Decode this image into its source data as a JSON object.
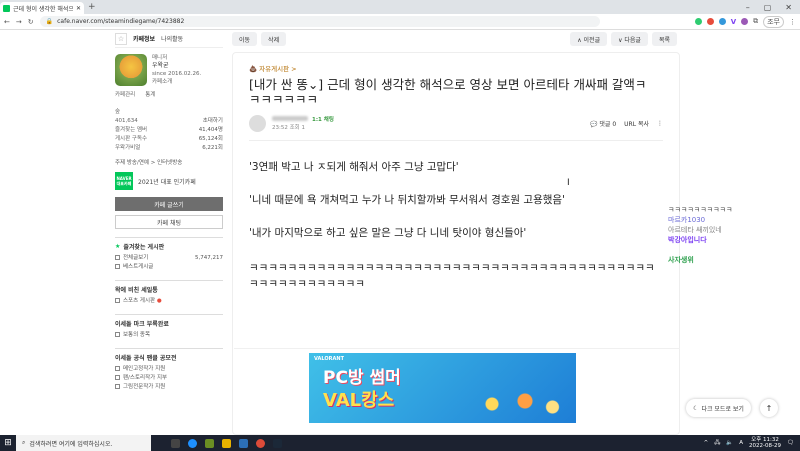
{
  "browser": {
    "tab_title": "근데 형이 생각한 해석으로 영상 보면...",
    "new_tab_symbol": "+",
    "window_controls": [
      "–",
      "▢",
      "✕"
    ],
    "url": "cafe.naver.com/steamindiegame/7423882",
    "profile_btn": "조무",
    "ext_letter": "V"
  },
  "sidebar": {
    "tabs": [
      "카페정보",
      "나의활동"
    ],
    "cafe": {
      "role": "매니저",
      "name": "우왁굳",
      "since": "since 2016.02.26.",
      "sub": "카페소개"
    },
    "admin": [
      "카페관리",
      "통계"
    ],
    "level_label": "숲",
    "members": {
      "count": "401,634",
      "label": "초대하기"
    },
    "stats": [
      {
        "label": "즐겨찾는 멤버",
        "value": "41,404명"
      },
      {
        "label": "게시판 구독수",
        "value": "65,124회"
      },
      {
        "label": "우왁가비얼",
        "value": "6,221회"
      }
    ],
    "theme_line": "주제 방송/연예 > 인터넷방송",
    "naver_badge": "NAVER 대표카페",
    "naver_text": "2021년 대표 인기카페",
    "write_btn": "카페 글쓰기",
    "chat_btn": "카페 채팅",
    "fav_section": "즐겨찾는 게시판",
    "fav_items": [
      {
        "label": "전체글보기",
        "value": "5,747,217"
      },
      {
        "label": "베스트게시글",
        "value": ""
      }
    ],
    "section2": "왁에 비친 세일통",
    "section2_items": [
      "스포츠 게시판"
    ],
    "section3": "이세돌 마크 부록완료",
    "section3_items": [
      "보통의 종목"
    ],
    "section4": "이세돌 공식 팬클 공모전",
    "section4_items": [
      "메인고정작가 지원",
      "팬/스토리작가 지부",
      "그림전문작가 지원"
    ]
  },
  "toolbar": {
    "move": "이동",
    "delete": "삭제",
    "prev": "∧ 이전글",
    "next": "∨ 다음글",
    "list": "목록"
  },
  "post": {
    "board": "자유게시판 >",
    "title": "[내가 싼 똥⌄] 근데 형이 생각한 해석으로 영상 보면 아르테타 개싸패 갈액ㅋㅋㅋㅋㅋㅋㅋ",
    "author_level": "1:1 채팅",
    "date": "23:52  조회 1",
    "comments": "댓글 0",
    "url_copy": "URL 복사",
    "paragraphs": [
      "'3연패 박고 나 ㅈ되게 해줘서 아주 그냥 고맙다'",
      "'니네 때문에 욕 개쳐먹고 누가 나 뒤치할까봐 무서워서 경호원 고용했음'",
      "'내가 마지막으로 하고 싶은 말은 그냥 다 니네 탓이야 형신들아'"
    ],
    "laughs": "ㅋㅋㅋㅋㅋㅋㅋㅋㅋㅋㅋㅋㅋㅋㅋㅋㅋㅋㅋㅋㅋㅋㅋㅋㅋㅋㅋㅋㅋㅋㅋㅋㅋㅋㅋㅋㅋㅋㅋㅋㅋㅋㅋㅋㅋㅋㅋㅋㅋㅋㅋㅋㅋㅋ"
  },
  "ad": {
    "logo": "VALORANT",
    "line1": "PC방 썸머",
    "line2": "VAL캉스"
  },
  "chat_overlay": {
    "line1": "ㅋㅋㅋㅋㅋㅋㅋㅋㅋㅋ",
    "line2": "마르카1030",
    "line3": "아르테타 쌔끼있네",
    "line4": "박강아입니다",
    "line5": "사자생위"
  },
  "dark_mode_btn": "다크 모드로 보기",
  "top_btn": "↑",
  "taskbar": {
    "search_placeholder": "검색하려면 여기에 입력하십시오.",
    "time": "오후 11:32",
    "date": "2022-08-29",
    "lang": "A"
  }
}
